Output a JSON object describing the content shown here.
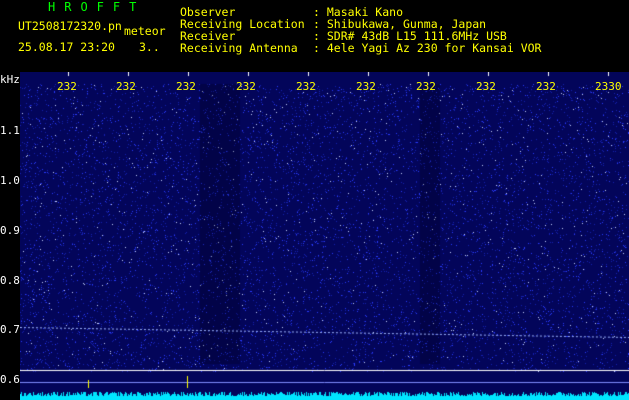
{
  "header": {
    "app_name": "HROFFT",
    "file_name": "UT2508172320.pn",
    "mode": "meteor",
    "datetime": "25.08.17 23:20",
    "count": "3..",
    "info_labels": [
      "Observer",
      "Receiving Location",
      "Receiver",
      "Receiving Antenna"
    ],
    "info_values": [
      ": Masaki Kano",
      ": Shibukawa, Gunma, Japan",
      ": SDR# 43dB L15 111.6MHz USB",
      ": 4ele Yagi Az 230 for Kansai VOR"
    ]
  },
  "spectrogram": {
    "unit_label": "kHz",
    "time_ticks": [
      "232",
      "232",
      "232",
      "232",
      "232",
      "232",
      "232",
      "232",
      "232",
      "2330"
    ],
    "freq_labels": [
      "1.1",
      "1.0",
      "0.9",
      "0.8",
      "0.7",
      "0.6"
    ],
    "colors": {
      "background": "#03055a",
      "noise": "#2a3cff",
      "signal": "#9db4ff",
      "lower_panel": "#00e5ff",
      "ref_line": "#ffffff"
    }
  }
}
